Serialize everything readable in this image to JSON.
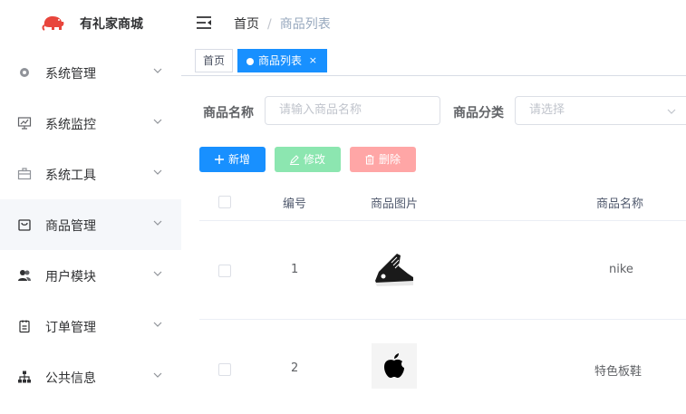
{
  "app": {
    "name": "有礼家商城"
  },
  "sidebar": {
    "items": [
      {
        "label": "系统管理",
        "icon": "gear-icon"
      },
      {
        "label": "系统监控",
        "icon": "monitor-icon"
      },
      {
        "label": "系统工具",
        "icon": "toolbox-icon"
      },
      {
        "label": "商品管理",
        "icon": "shopping-bag-icon",
        "active": true
      },
      {
        "label": "用户模块",
        "icon": "users-icon"
      },
      {
        "label": "订单管理",
        "icon": "clipboard-icon"
      },
      {
        "label": "公共信息",
        "icon": "sitemap-icon"
      }
    ]
  },
  "breadcrumb": {
    "home": "首页",
    "separator": "/",
    "current": "商品列表"
  },
  "tags": {
    "home": "首页",
    "active": "商品列表",
    "close": "×"
  },
  "search": {
    "name_label": "商品名称",
    "name_placeholder": "请输入商品名称",
    "category_label": "商品分类",
    "category_placeholder": "请选择"
  },
  "toolbar": {
    "add": "新增",
    "edit": "修改",
    "delete": "删除"
  },
  "table": {
    "headers": [
      "编号",
      "商品图片",
      "商品名称"
    ],
    "rows": [
      {
        "id": "1",
        "image": "black-sneaker-image",
        "name": "nike"
      },
      {
        "id": "2",
        "image": "apple-logo-image",
        "name": "特色板鞋"
      }
    ]
  },
  "colors": {
    "primary": "#1890ff",
    "success_light": "#8ce6b0",
    "danger_light": "#ffa6a6",
    "brand_red": "#e8453c"
  }
}
